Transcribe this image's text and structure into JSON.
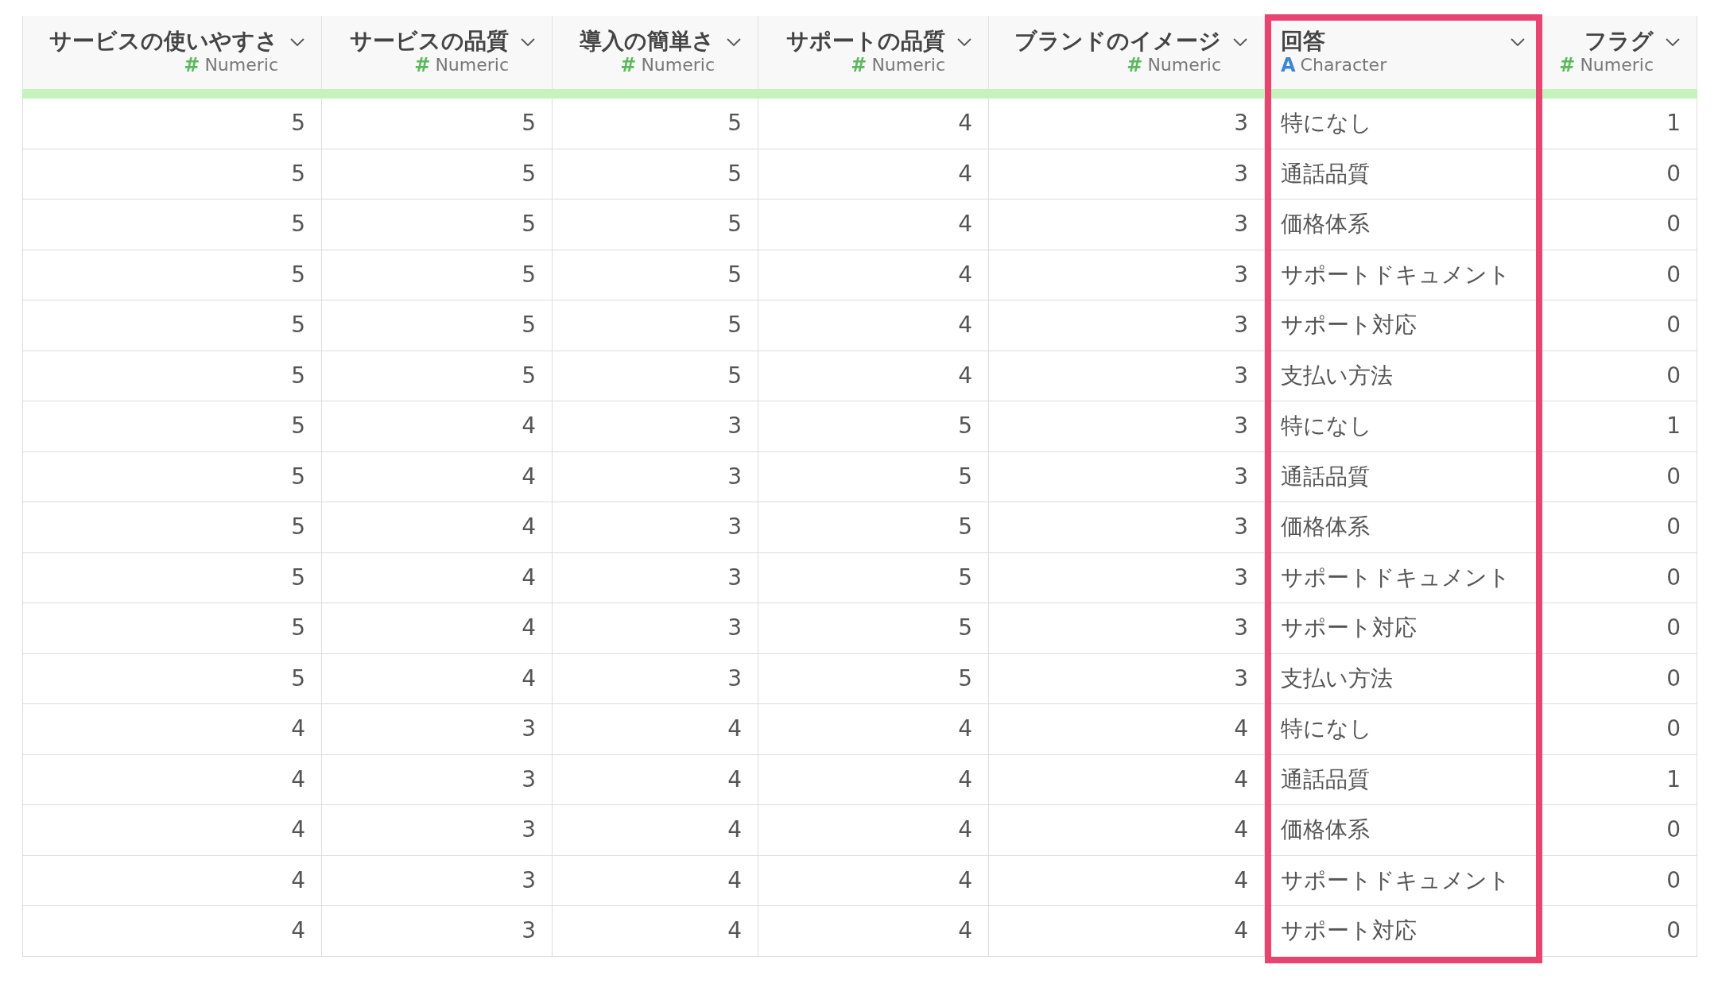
{
  "table": {
    "columns": [
      {
        "name": "サービスの使いやすさ",
        "kind": "numeric",
        "type_icon": "#",
        "type_label": "Numeric",
        "highlighted": false
      },
      {
        "name": "サービスの品質",
        "kind": "numeric",
        "type_icon": "#",
        "type_label": "Numeric",
        "highlighted": false
      },
      {
        "name": "導入の簡単さ",
        "kind": "numeric",
        "type_icon": "#",
        "type_label": "Numeric",
        "highlighted": false
      },
      {
        "name": "サポートの品質",
        "kind": "numeric",
        "type_icon": "#",
        "type_label": "Numeric",
        "highlighted": false
      },
      {
        "name": "ブランドのイメージ",
        "kind": "numeric",
        "type_icon": "#",
        "type_label": "Numeric",
        "highlighted": false
      },
      {
        "name": "回答",
        "kind": "character",
        "type_icon": "A",
        "type_label": "Character",
        "highlighted": true
      },
      {
        "name": "フラグ",
        "kind": "numeric",
        "type_icon": "#",
        "type_label": "Numeric",
        "highlighted": false
      }
    ],
    "rows": [
      [
        "5",
        "5",
        "5",
        "4",
        "3",
        "特になし",
        "1"
      ],
      [
        "5",
        "5",
        "5",
        "4",
        "3",
        "通話品質",
        "0"
      ],
      [
        "5",
        "5",
        "5",
        "4",
        "3",
        "価格体系",
        "0"
      ],
      [
        "5",
        "5",
        "5",
        "4",
        "3",
        "サポートドキュメント",
        "0"
      ],
      [
        "5",
        "5",
        "5",
        "4",
        "3",
        "サポート対応",
        "0"
      ],
      [
        "5",
        "5",
        "5",
        "4",
        "3",
        "支払い方法",
        "0"
      ],
      [
        "5",
        "4",
        "3",
        "5",
        "3",
        "特になし",
        "1"
      ],
      [
        "5",
        "4",
        "3",
        "5",
        "3",
        "通話品質",
        "0"
      ],
      [
        "5",
        "4",
        "3",
        "5",
        "3",
        "価格体系",
        "0"
      ],
      [
        "5",
        "4",
        "3",
        "5",
        "3",
        "サポートドキュメント",
        "0"
      ],
      [
        "5",
        "4",
        "3",
        "5",
        "3",
        "サポート対応",
        "0"
      ],
      [
        "5",
        "4",
        "3",
        "5",
        "3",
        "支払い方法",
        "0"
      ],
      [
        "4",
        "3",
        "4",
        "4",
        "4",
        "特になし",
        "0"
      ],
      [
        "4",
        "3",
        "4",
        "4",
        "4",
        "通話品質",
        "1"
      ],
      [
        "4",
        "3",
        "4",
        "4",
        "4",
        "価格体系",
        "0"
      ],
      [
        "4",
        "3",
        "4",
        "4",
        "4",
        "サポートドキュメント",
        "0"
      ],
      [
        "4",
        "3",
        "4",
        "4",
        "4",
        "サポート対応",
        "0"
      ]
    ]
  }
}
